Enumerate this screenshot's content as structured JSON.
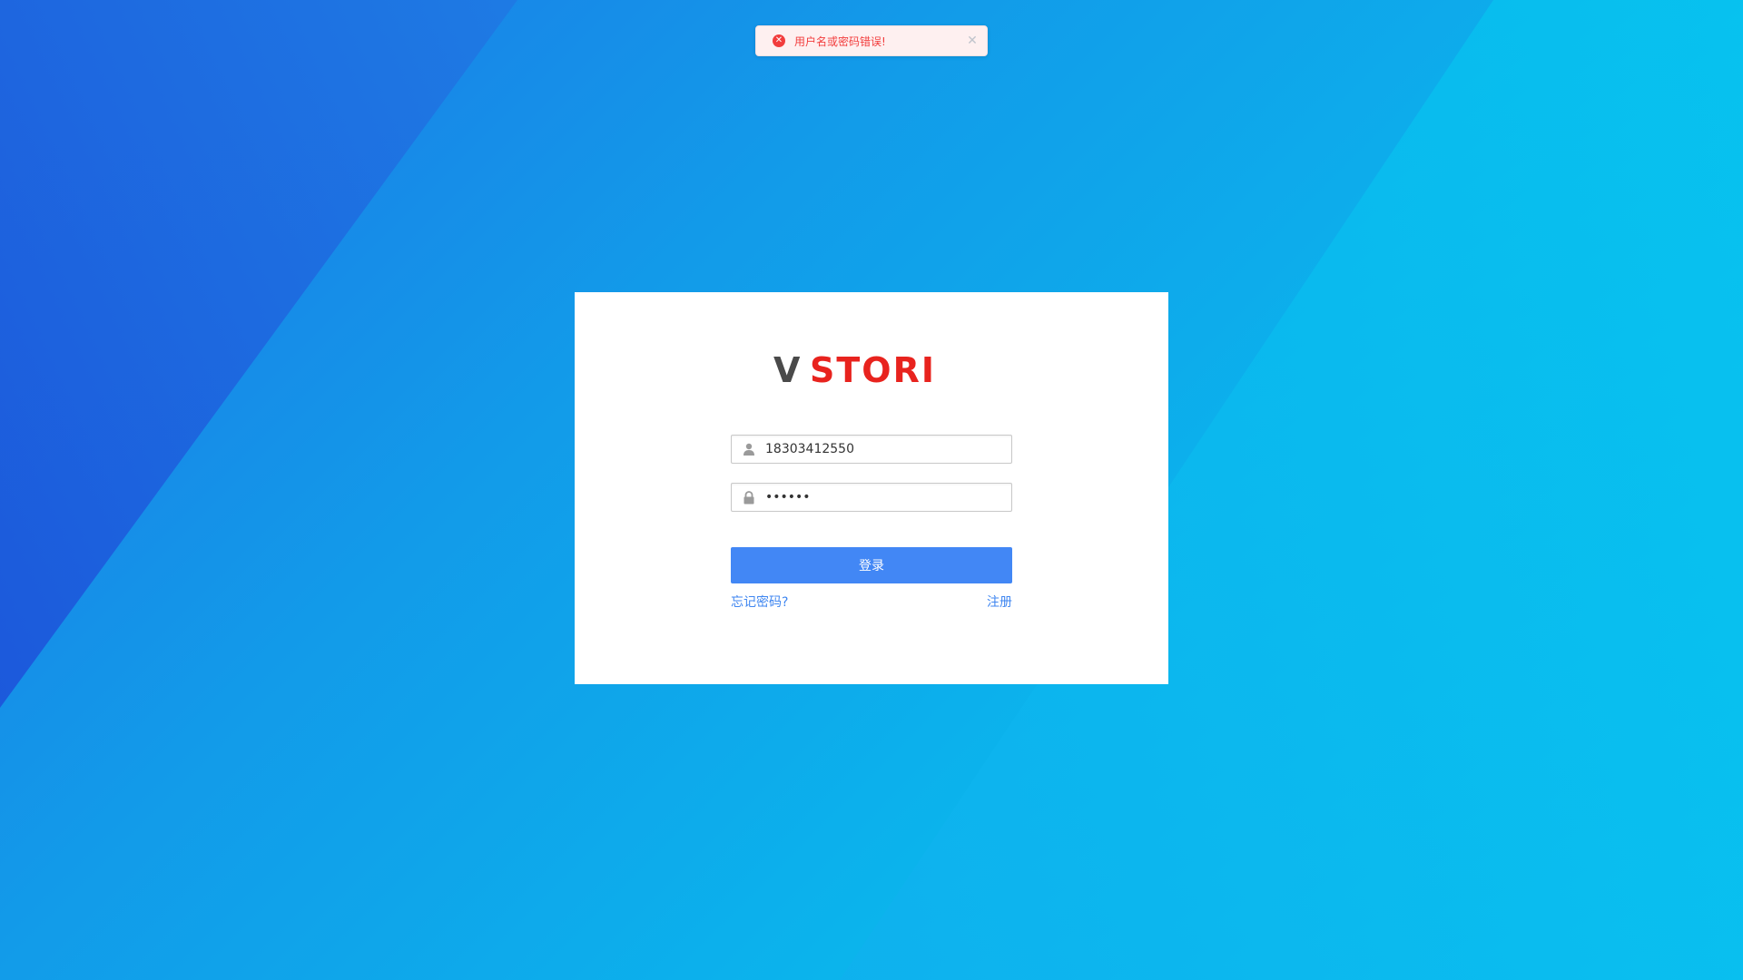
{
  "toast": {
    "icon": "error-circle-icon",
    "message": "用户名或密码错误!",
    "close_icon": "close-icon",
    "color": "#f23d3d"
  },
  "logo": {
    "prefix": "V",
    "suffix": "STORI",
    "prefix_color": "#4a4a4a",
    "suffix_color": "#e8231e"
  },
  "login_form": {
    "username_icon": "user-icon",
    "username_value": "18303412550",
    "password_icon": "lock-icon",
    "password_value": "111111",
    "submit_label": "登录",
    "forgot_label": "忘记密码?",
    "register_label": "注册",
    "button_color": "#4287f5",
    "link_color": "#3f86f0"
  }
}
